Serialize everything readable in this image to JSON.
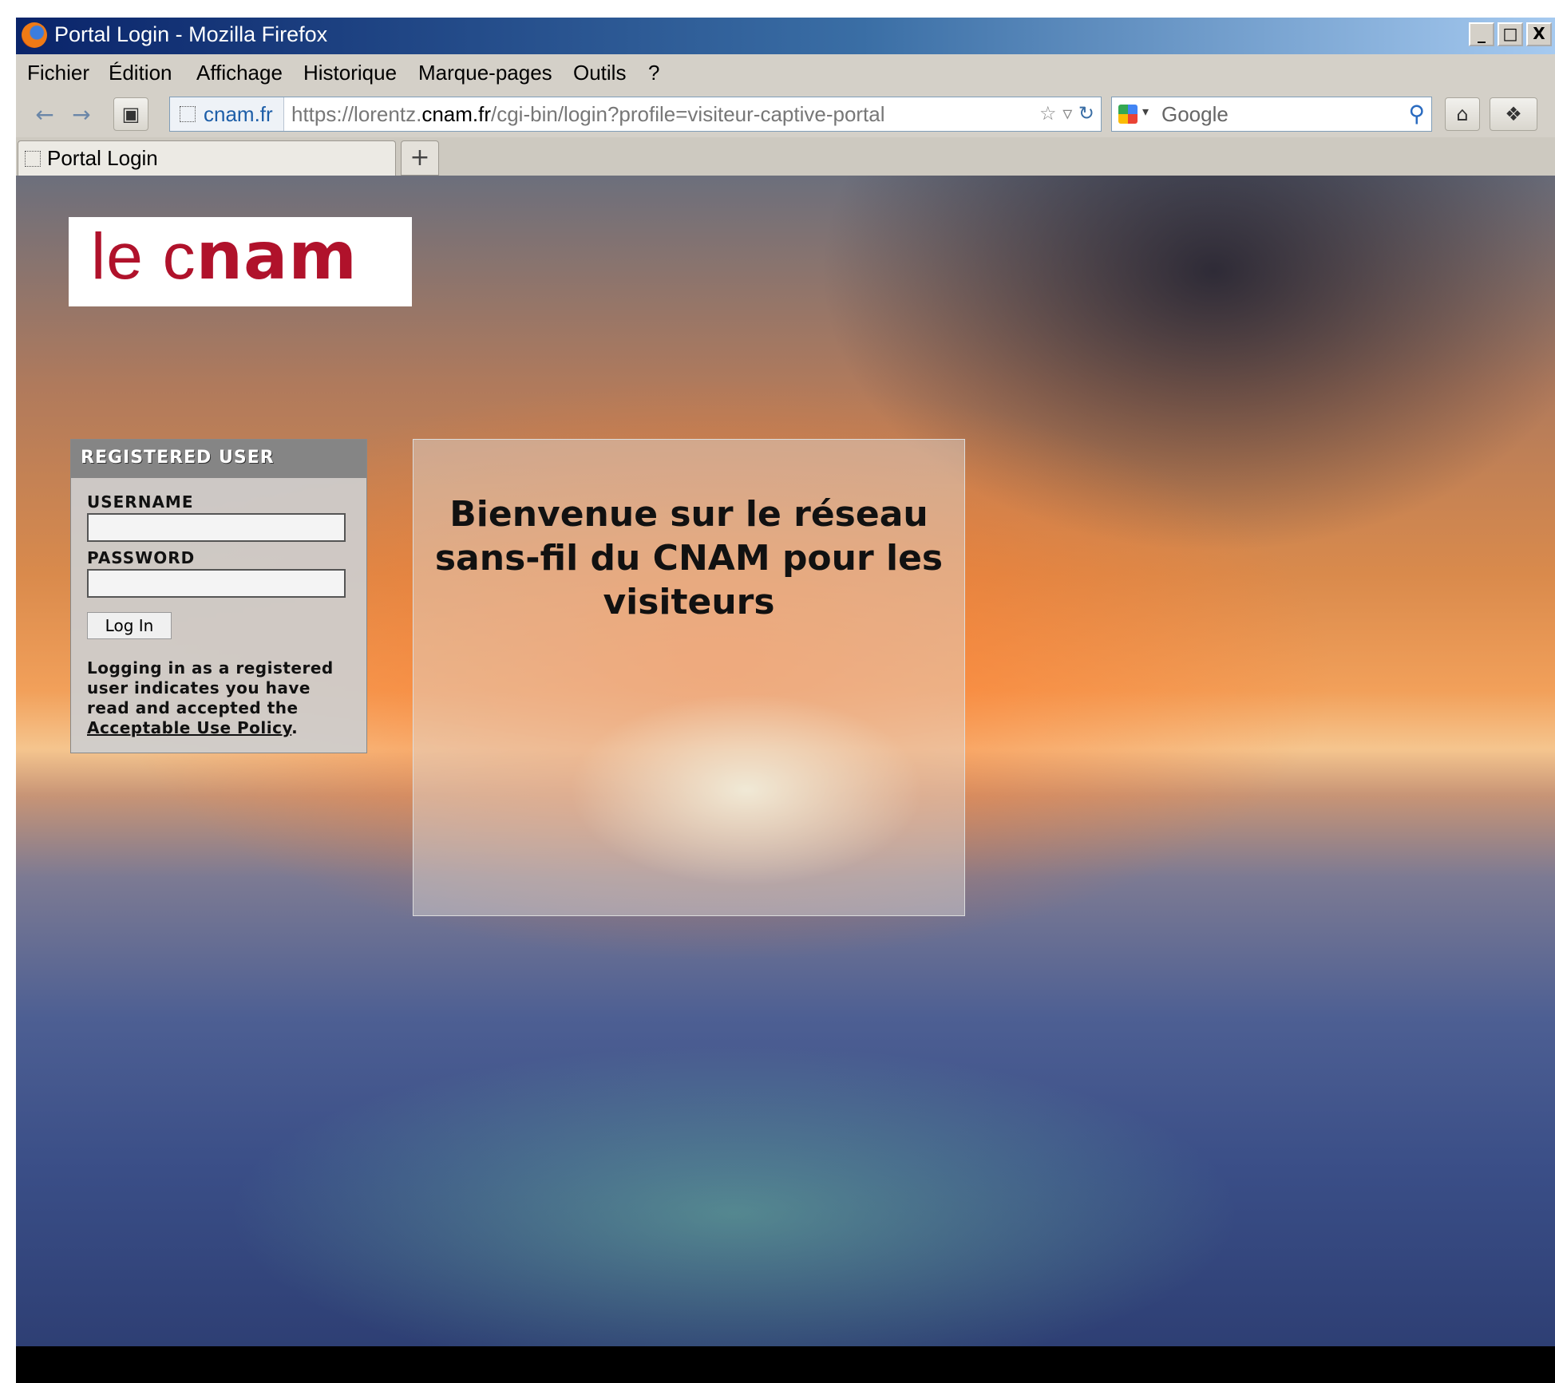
{
  "window": {
    "title": "Portal Login - Mozilla Firefox",
    "buttons": {
      "minimize": "_",
      "maximize": "□",
      "close": "X"
    }
  },
  "menu": {
    "items": [
      {
        "label": "Fichier"
      },
      {
        "label": "Édition"
      },
      {
        "label": "Affichage"
      },
      {
        "label": "Historique"
      },
      {
        "label": "Marque-pages"
      },
      {
        "label": "Outils"
      },
      {
        "label": "?"
      }
    ]
  },
  "navbar": {
    "site_identity": "cnam.fr",
    "url_prefix": "https://lorentz.",
    "url_host": "cnam.fr",
    "url_path": "/cgi-bin/login?profile=visiteur-captive-portal",
    "search_placeholder": "Google",
    "icons": [
      "back-icon",
      "forward-icon",
      "bookmark-add-icon",
      "star-icon",
      "dropdown-icon",
      "reload-icon",
      "google-icon",
      "search-icon",
      "home-icon",
      "addon-icon"
    ]
  },
  "tabs": [
    {
      "label": "Portal Login"
    }
  ],
  "new_tab_label": "+",
  "page": {
    "logo": {
      "light": "le c",
      "bold": "nam"
    },
    "login": {
      "header": "REGISTERED USER",
      "username_label": "USERNAME",
      "password_label": "PASSWORD",
      "button_label": "Log In",
      "policy_text": "Logging in as a registered user indicates you have read and accepted the ",
      "policy_link": "Acceptable Use Policy",
      "policy_end": "."
    },
    "welcome": "Bienvenue sur le réseau sans-fil du CNAM pour les visiteurs"
  },
  "colors": {
    "brand_red": "#b0122b",
    "titlebar_start": "#0a246a",
    "chrome_gray": "#d4d0c8"
  }
}
